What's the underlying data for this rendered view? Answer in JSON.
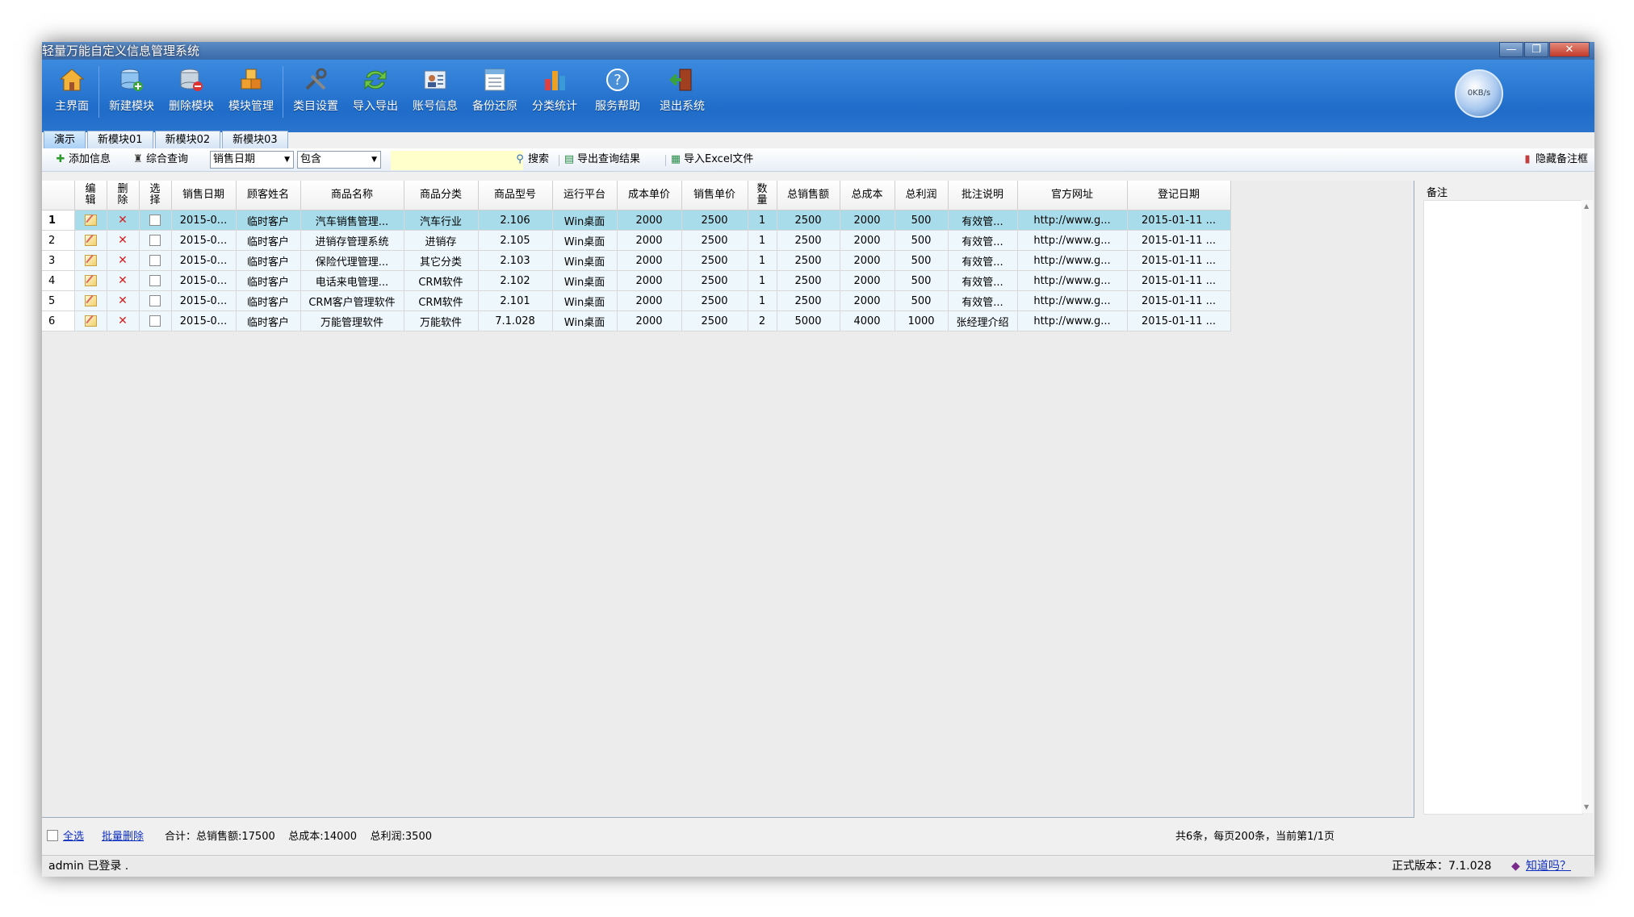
{
  "window": {
    "title": "轻量万能自定义信息管理系统",
    "controls": {
      "minimize": "—",
      "maximize": "❐",
      "close": "✕"
    }
  },
  "toolbar": {
    "items": [
      {
        "label": "主界面",
        "icon": "home-icon"
      },
      {
        "label": "新建模块",
        "icon": "new-module-icon"
      },
      {
        "label": "删除模块",
        "icon": "delete-module-icon"
      },
      {
        "label": "模块管理",
        "icon": "module-manage-icon"
      },
      {
        "label": "类目设置",
        "icon": "tools-icon"
      },
      {
        "label": "导入导出",
        "icon": "import-export-icon"
      },
      {
        "label": "账号信息",
        "icon": "account-icon"
      },
      {
        "label": "备份还原",
        "icon": "backup-icon"
      },
      {
        "label": "分类统计",
        "icon": "bar-chart-icon"
      },
      {
        "label": "服务帮助",
        "icon": "help-icon"
      },
      {
        "label": "退出系统",
        "icon": "exit-icon"
      }
    ],
    "speed": "0KB/s"
  },
  "tabs": [
    "演示",
    "新模块01",
    "新模块02",
    "新模块03"
  ],
  "actions": {
    "add": "添加信息",
    "query": "综合查询",
    "field_select": "销售日期",
    "op_select": "包含",
    "search": "搜索",
    "export_results": "导出查询结果",
    "import_excel": "导入Excel文件",
    "hide_remarks": "隐藏备注框"
  },
  "grid": {
    "columns": [
      "编辑",
      "删除",
      "选择",
      "销售日期",
      "顾客姓名",
      "商品名称",
      "商品分类",
      "商品型号",
      "运行平台",
      "成本单价",
      "销售单价",
      "数量",
      "总销售额",
      "总成本",
      "总利润",
      "批注说明",
      "官方网址",
      "登记日期"
    ],
    "rows": [
      {
        "idx": "1",
        "date": "2015-0...",
        "customer": "临时客户",
        "product": "汽车销售管理...",
        "category": "汽车行业",
        "model": "2.106",
        "platform": "Win桌面",
        "cost": "2000",
        "price": "2500",
        "qty": "1",
        "total_sales": "2500",
        "total_cost": "2000",
        "profit": "500",
        "note": "有效管...",
        "url": "http://www.g...",
        "reg_date": "2015-01-11 ..."
      },
      {
        "idx": "2",
        "date": "2015-0...",
        "customer": "临时客户",
        "product": "进销存管理系统",
        "category": "进销存",
        "model": "2.105",
        "platform": "Win桌面",
        "cost": "2000",
        "price": "2500",
        "qty": "1",
        "total_sales": "2500",
        "total_cost": "2000",
        "profit": "500",
        "note": "有效管...",
        "url": "http://www.g...",
        "reg_date": "2015-01-11 ..."
      },
      {
        "idx": "3",
        "date": "2015-0...",
        "customer": "临时客户",
        "product": "保险代理管理...",
        "category": "其它分类",
        "model": "2.103",
        "platform": "Win桌面",
        "cost": "2000",
        "price": "2500",
        "qty": "1",
        "total_sales": "2500",
        "total_cost": "2000",
        "profit": "500",
        "note": "有效管...",
        "url": "http://www.g...",
        "reg_date": "2015-01-11 ..."
      },
      {
        "idx": "4",
        "date": "2015-0...",
        "customer": "临时客户",
        "product": "电话来电管理...",
        "category": "CRM软件",
        "model": "2.102",
        "platform": "Win桌面",
        "cost": "2000",
        "price": "2500",
        "qty": "1",
        "total_sales": "2500",
        "total_cost": "2000",
        "profit": "500",
        "note": "有效管...",
        "url": "http://www.g...",
        "reg_date": "2015-01-11 ..."
      },
      {
        "idx": "5",
        "date": "2015-0...",
        "customer": "临时客户",
        "product": "CRM客户管理软件",
        "category": "CRM软件",
        "model": "2.101",
        "platform": "Win桌面",
        "cost": "2000",
        "price": "2500",
        "qty": "1",
        "total_sales": "2500",
        "total_cost": "2000",
        "profit": "500",
        "note": "有效管...",
        "url": "http://www.g...",
        "reg_date": "2015-01-11 ..."
      },
      {
        "idx": "6",
        "date": "2015-0...",
        "customer": "临时客户",
        "product": "万能管理软件",
        "category": "万能软件",
        "model": "7.1.028",
        "platform": "Win桌面",
        "cost": "2000",
        "price": "2500",
        "qty": "2",
        "total_sales": "5000",
        "total_cost": "4000",
        "profit": "1000",
        "note": "张经理介绍",
        "url": "http://www.g...",
        "reg_date": "2015-01-11 ..."
      }
    ]
  },
  "remarks": {
    "title": "备注"
  },
  "footer": {
    "select_all": "全选",
    "batch_delete": "批量删除",
    "totals": "合计：总销售额:17500    总成本:14000    总利润:3500",
    "paging": "共6条，每页200条，当前第1/1页"
  },
  "status": {
    "login": "admin 已登录 .",
    "version": "正式版本：7.1.028",
    "know": "知道吗？"
  },
  "colors": {
    "toolbar": "#2a78d4",
    "selected_row": "#a9dcea",
    "row_bg": "#eef7fb",
    "link": "#1030c0",
    "delete_mark": "#d42020"
  }
}
